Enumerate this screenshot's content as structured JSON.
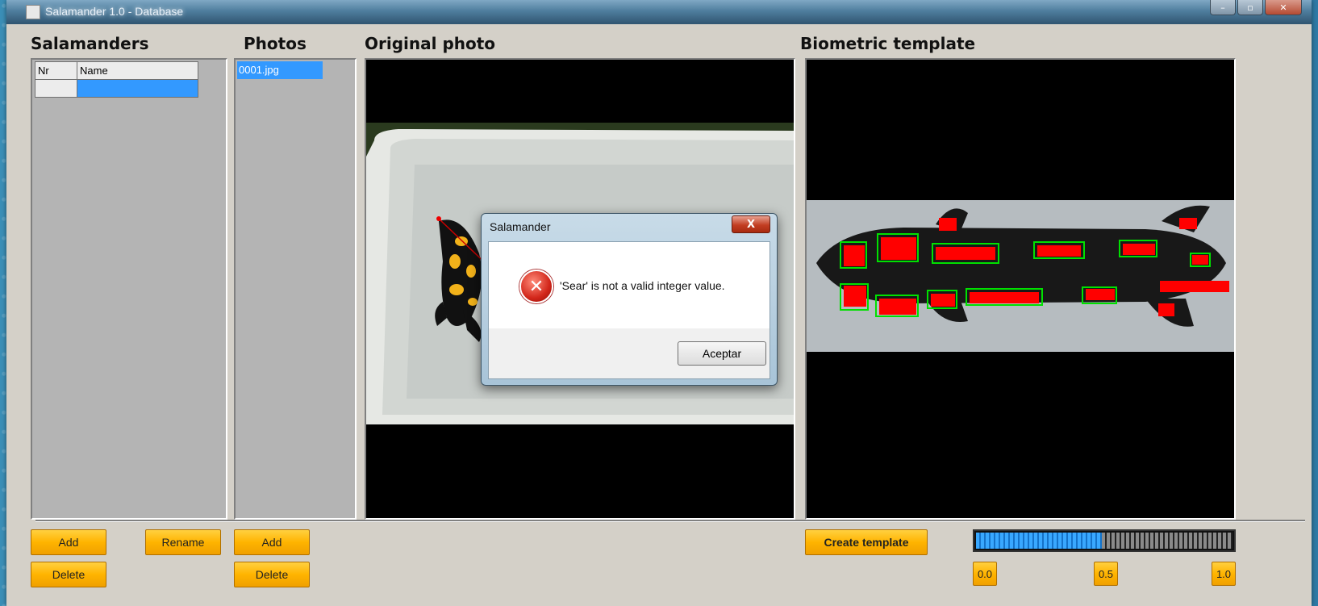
{
  "window": {
    "title": "Salamander 1.0 - Database",
    "controls": [
      "–",
      "▫",
      "✕"
    ]
  },
  "headers": {
    "salamanders": "Salamanders",
    "photos": "Photos",
    "original": "Original photo",
    "template": "Biometric template"
  },
  "salamanders_table": {
    "columns": [
      "Nr",
      "Name"
    ],
    "rows": [
      [
        "",
        ""
      ]
    ]
  },
  "photos_list": {
    "items": [
      "0001.jpg"
    ]
  },
  "buttons": {
    "add_salamander": "Add",
    "rename_salamander": "Rename",
    "delete_salamander": "Delete",
    "add_photo": "Add",
    "delete_photo": "Delete",
    "create_template": "Create template"
  },
  "threshold": {
    "progress": 0.49,
    "ticks": [
      "0.0",
      "0.5",
      "1.0"
    ]
  },
  "dialog": {
    "title": "Salamander",
    "close": "X",
    "message": "'Sear' is not a valid integer value.",
    "ok": "Aceptar",
    "icon": "error-icon"
  },
  "colors": {
    "accent_button": "#ffb400",
    "selection": "#3399ff",
    "progress_fill": "#1e8fe8"
  }
}
